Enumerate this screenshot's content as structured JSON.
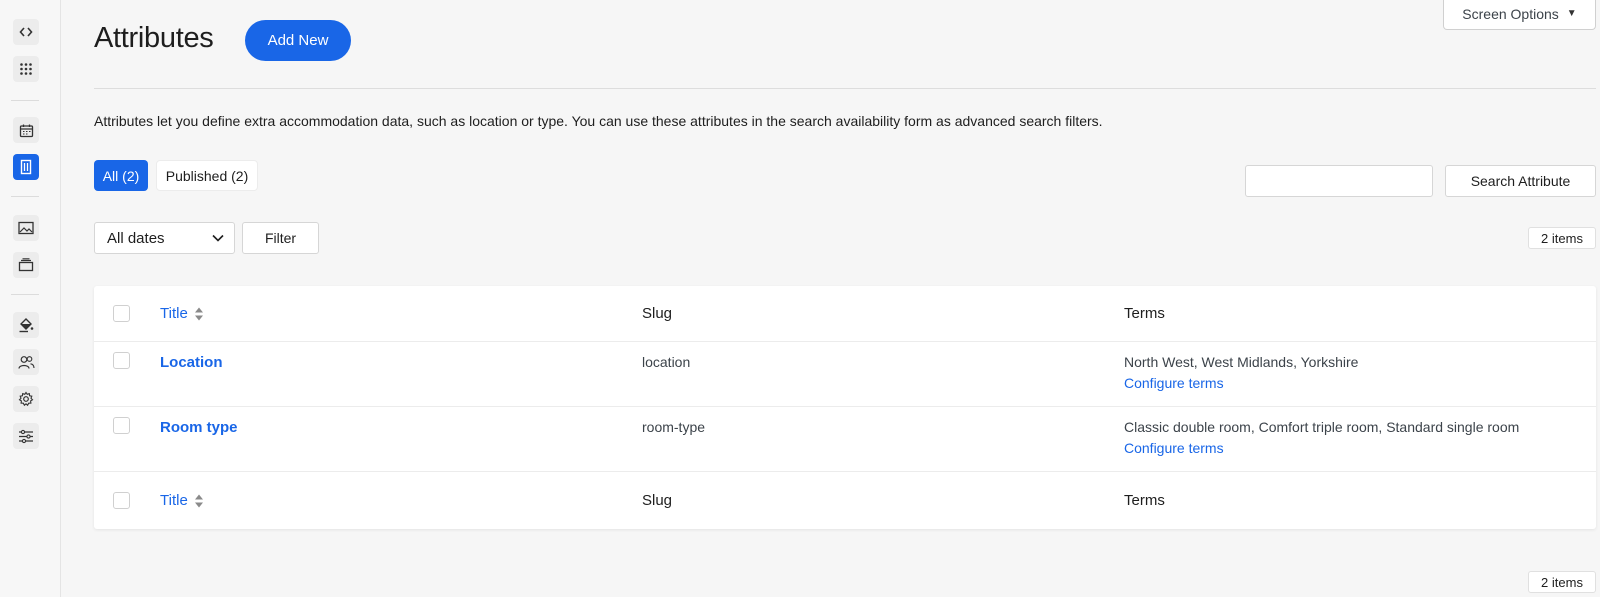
{
  "sidebar": {
    "icons": [
      "code-icon",
      "apps-grid-icon",
      "calendar-icon",
      "building-icon",
      "image-icon",
      "layers-icon",
      "paint-bucket-icon",
      "users-icon",
      "gear-icon",
      "sliders-icon"
    ]
  },
  "header": {
    "title": "Attributes",
    "add_new_label": "Add New",
    "screen_options_label": "Screen Options"
  },
  "description": "Attributes let you define extra accommodation data, such as location or type. You can use these attributes in the search availability form as advanced search filters.",
  "filters": {
    "all_label": "All (2)",
    "published_label": "Published (2)",
    "search_value": "",
    "search_button_label": "Search Attribute",
    "dates_selected": "All dates",
    "filter_button_label": "Filter",
    "items_count_top": "2 items",
    "items_count_bottom": "2 items"
  },
  "table": {
    "columns": {
      "title": "Title",
      "slug": "Slug",
      "terms": "Terms"
    },
    "rows": [
      {
        "title": "Location",
        "slug": "location",
        "terms": "North West, West Midlands, Yorkshire",
        "action": "Configure terms"
      },
      {
        "title": "Room type",
        "slug": "room-type",
        "terms": "Classic double room, Comfort triple room, Standard single room",
        "action": "Configure terms"
      }
    ]
  },
  "colors": {
    "accent": "#1966e7",
    "background": "#f6f6f6"
  }
}
